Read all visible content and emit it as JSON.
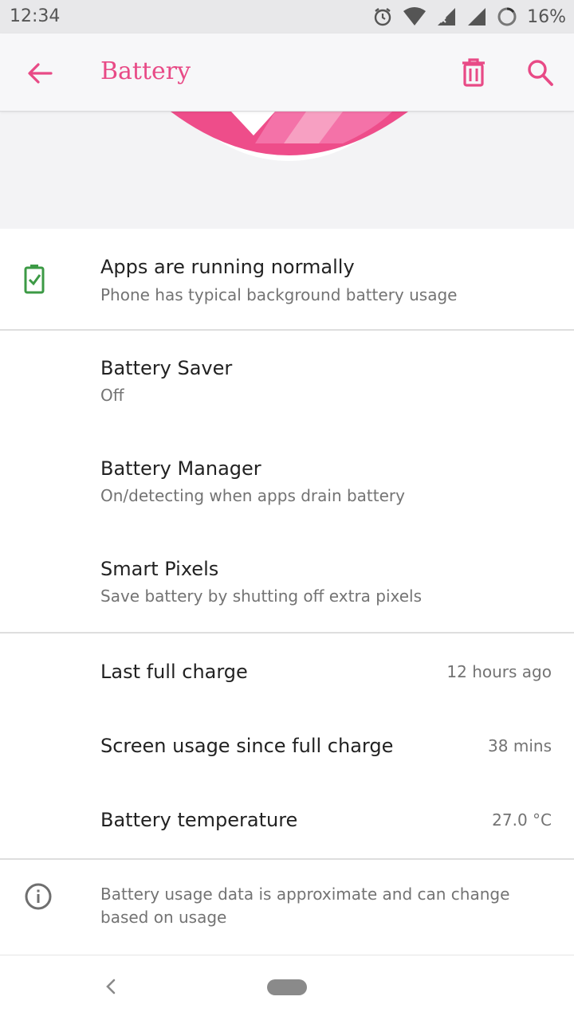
{
  "status_bar": {
    "time": "12:34",
    "battery_percent": "16%",
    "icons": [
      "alarm-icon",
      "wifi-icon",
      "signal-icon",
      "signal-icon",
      "battery-ring-icon"
    ]
  },
  "app_bar": {
    "title": "Battery",
    "accent_color": "#e84a86"
  },
  "summary": {
    "title": "Apps are running normally",
    "subtitle": "Phone has typical background battery usage",
    "status_color": "#3c9a45"
  },
  "settings": [
    {
      "title": "Battery Saver",
      "subtitle": "Off"
    },
    {
      "title": "Battery Manager",
      "subtitle": "On/detecting when apps drain battery"
    },
    {
      "title": "Smart Pixels",
      "subtitle": "Save battery by shutting off extra pixels"
    }
  ],
  "stats": [
    {
      "label": "Last full charge",
      "value": "12 hours ago"
    },
    {
      "label": "Screen usage since full charge",
      "value": "38 mins"
    },
    {
      "label": "Battery temperature",
      "value": "27.0 °C"
    }
  ],
  "footer_note": {
    "line1": "Battery usage data is approximate and can change",
    "line2": "based on usage"
  }
}
